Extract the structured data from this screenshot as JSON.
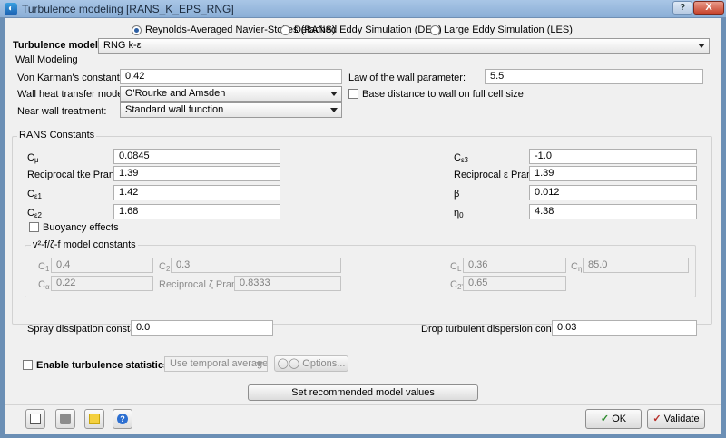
{
  "window": {
    "title": "Turbulence modeling [RANS_K_EPS_RNG]",
    "help_label": "?",
    "close_label": "X"
  },
  "mode": {
    "options": [
      {
        "label": "Reynolds-Averaged Navier-Stokes (RANS)",
        "selected": true
      },
      {
        "label": "Detached Eddy Simulation (DES)",
        "selected": false
      },
      {
        "label": "Large Eddy Simulation (LES)",
        "selected": false
      }
    ]
  },
  "turbulence_model": {
    "label": "Turbulence model:",
    "value": "RNG k-ε"
  },
  "wall": {
    "title": "Wall Modeling",
    "karman_label": "Von Karman's constant:",
    "karman_value": "0.42",
    "law_label": "Law of the wall parameter:",
    "law_value": "5.5",
    "heat_label": "Wall heat transfer model:",
    "heat_value": "O'Rourke and Amsden",
    "base_label": "Base distance to wall on full cell size",
    "near_label": "Near wall treatment:",
    "near_value": "Standard wall function"
  },
  "rans": {
    "title": "RANS Constants",
    "cmu_label": "C",
    "cmu_sub": "μ",
    "cmu_value": "0.0845",
    "ce3_label": "C",
    "ce3_sub": "ε3",
    "ce3_value": "-1.0",
    "rtke_label": "Reciprocal tke Prandtl",
    "rtke_value": "1.39",
    "reps_label": "Reciprocal ε Prandtl",
    "reps_value": "1.39",
    "ce1_label": "C",
    "ce1_sub": "ε1",
    "ce1_value": "1.42",
    "beta_label": "β",
    "beta_value": "0.012",
    "ce2_label": "C",
    "ce2_sub": "ε2",
    "ce2_value": "1.68",
    "eta_label": "η",
    "eta_sub": "0",
    "eta_value": "4.38",
    "buoy_label": "Buoyancy effects"
  },
  "v2f": {
    "title": "v²-f/ζ-f model constants",
    "c1_label": "C",
    "c1_sub": "1",
    "c1_value": "0.4",
    "c2_label": "C",
    "c2_sub": "2",
    "c2_value": "0.3",
    "cl_label": "C",
    "cl_sub": "L",
    "cl_value": "0.36",
    "cn_label": "C",
    "cn_sub": "η",
    "cn_value": "85.0",
    "ca_label": "C",
    "ca_sub": "α",
    "ca_value": "0.22",
    "rz_label": "Reciprocal ζ Prandtl",
    "rz_value": "0.8333",
    "c2p_label": "C",
    "c2p_sub": "2'",
    "c2p_value": "0.65"
  },
  "spray": {
    "label": "Spray dissipation constant",
    "value": "0.0"
  },
  "drop": {
    "label": "Drop turbulent dispersion constant",
    "value": "0.03"
  },
  "stats": {
    "label": "Enable turbulence statistics",
    "select_value": "Use temporal average",
    "options_label": "Options..."
  },
  "recommend_label": "Set recommended model values",
  "footer": {
    "ok_label": "OK",
    "validate_label": "Validate"
  },
  "colors": {
    "title_bar": "#9dbde0",
    "panel": "#f0f0f0",
    "accent": "#2d5fa3"
  }
}
